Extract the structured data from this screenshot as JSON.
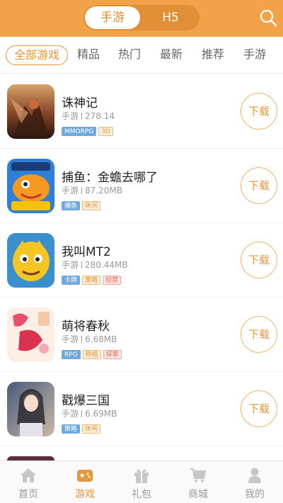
{
  "header": {
    "tabs": [
      {
        "label": "手游",
        "active": true
      },
      {
        "label": "H5",
        "active": false
      }
    ],
    "search_icon": "search-icon",
    "brand_color": "#f2a34a"
  },
  "categories": [
    {
      "label": "全部游戏",
      "active": true
    },
    {
      "label": "精品"
    },
    {
      "label": "热门"
    },
    {
      "label": "最新"
    },
    {
      "label": "推荐"
    },
    {
      "label": "手游"
    }
  ],
  "games": [
    {
      "title": "诛神记",
      "platform": "手游",
      "size": "278.14",
      "tags": [
        {
          "text": "MMORPG",
          "color": "blue"
        },
        {
          "text": "3D",
          "color": "orange"
        }
      ],
      "download_label": "下载"
    },
    {
      "title": "捕鱼：金蟾去哪了",
      "platform": "手游",
      "size": "87.20MB",
      "tags": [
        {
          "text": "捕鱼",
          "color": "blue"
        },
        {
          "text": "休闲",
          "color": "orange"
        }
      ],
      "download_label": "下载"
    },
    {
      "title": "我叫MT2",
      "platform": "手游",
      "size": "280.44MB",
      "tags": [
        {
          "text": "卡牌",
          "color": "blue"
        },
        {
          "text": "策略",
          "color": "orange"
        },
        {
          "text": "经营",
          "color": "red"
        }
      ],
      "download_label": "下载"
    },
    {
      "title": "萌将春秋",
      "platform": "手游",
      "size": "6.68MB",
      "tags": [
        {
          "text": "RPG",
          "color": "blue"
        },
        {
          "text": "移植",
          "color": "orange"
        },
        {
          "text": "探索",
          "color": "red"
        }
      ],
      "download_label": "下载"
    },
    {
      "title": "戳爆三国",
      "platform": "手游",
      "size": "6.69MB",
      "tags": [
        {
          "text": "策略",
          "color": "blue"
        },
        {
          "text": "休闲",
          "color": "orange"
        }
      ],
      "download_label": "下载"
    }
  ],
  "bottom_nav": [
    {
      "label": "首页",
      "icon": "home-icon",
      "active": false
    },
    {
      "label": "游戏",
      "icon": "gamepad-icon",
      "active": true
    },
    {
      "label": "礼包",
      "icon": "gift-icon",
      "active": false
    },
    {
      "label": "商城",
      "icon": "cart-icon",
      "active": false
    },
    {
      "label": "我的",
      "icon": "user-icon",
      "active": false
    }
  ]
}
